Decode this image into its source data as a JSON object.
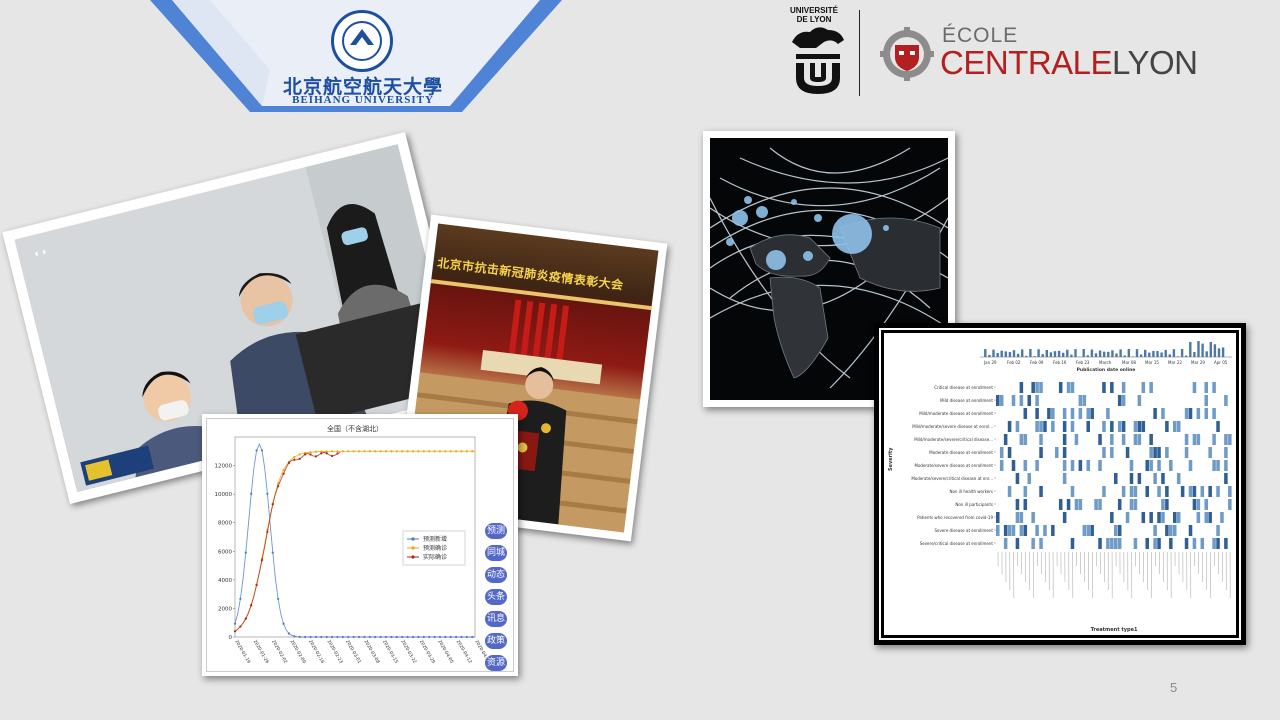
{
  "slide": {
    "page_number": "5"
  },
  "logos": {
    "beihang_cn": "北京航空航天大學",
    "beihang_en": "BEIHANG UNIVERSITY",
    "lyon_line1": "UNIVERSITÉ",
    "lyon_line2": "DE LYON",
    "ecl_ecole": "ÉCOLE",
    "ecl_centrale": "CENTRALE",
    "ecl_lyon": "LYON"
  },
  "ceremony": {
    "banner": "北京市抗击新冠肺炎疫情表彰大会"
  },
  "chart_data": {
    "type": "line",
    "title": "全国（不含湖北）",
    "ylim": [
      0,
      14000
    ],
    "yticks": [
      "0",
      "2000",
      "4000",
      "6000",
      "8000",
      "10000",
      "12000"
    ],
    "xticks": [
      "2020-01-19",
      "2020-01-26",
      "2020-02-02",
      "2020-02-09",
      "2020-02-16",
      "2020-02-23",
      "2020-03-01",
      "2020-03-08",
      "2020-03-15",
      "2020-03-22",
      "2020-03-29",
      "2020-04-05",
      "2020-04-12",
      "2020-04-19"
    ],
    "series": [
      {
        "name": "预测新增",
        "color": "#4e79c4"
      },
      {
        "name": "预测确诊",
        "color": "#f0a500"
      },
      {
        "name": "实际确诊",
        "color": "#b02418"
      }
    ],
    "side_buttons": [
      "预测",
      "同城",
      "动态",
      "头条",
      "讯息",
      "政策",
      "资源"
    ]
  },
  "heatmap": {
    "xlabel": "Treatment type1",
    "ylabel": "Severity",
    "top_label": "Publication date online",
    "top_ticks": [
      "Jan 29",
      "Feb 02",
      "Feb 09",
      "Feb 16",
      "Feb 23",
      "March",
      "Mar 08",
      "Mar 15",
      "Mar 22",
      "Mar 29",
      "Apr 05"
    ],
    "rows": [
      "Critical disease at enrollment",
      "Mild disease at enrollment",
      "Mild/moderate disease at enrollment",
      "Mild/moderate/severe disease at enrol...",
      "Mild/moderate/severe/critical disease...",
      "Moderate disease at enrollment",
      "Moderate/severe disease at enrollment",
      "Moderate/severe/critical disease at enr...",
      "Non ill health workers",
      "Non ill participants",
      "Patients who recovered from covid-19",
      "Severe disease at enrollment",
      "Severe/critical disease at enrollment"
    ]
  },
  "colors": {
    "beihang_blue": "#1d4fa0",
    "centrale_red": "#b3201f",
    "background": "#e6e6e6"
  }
}
